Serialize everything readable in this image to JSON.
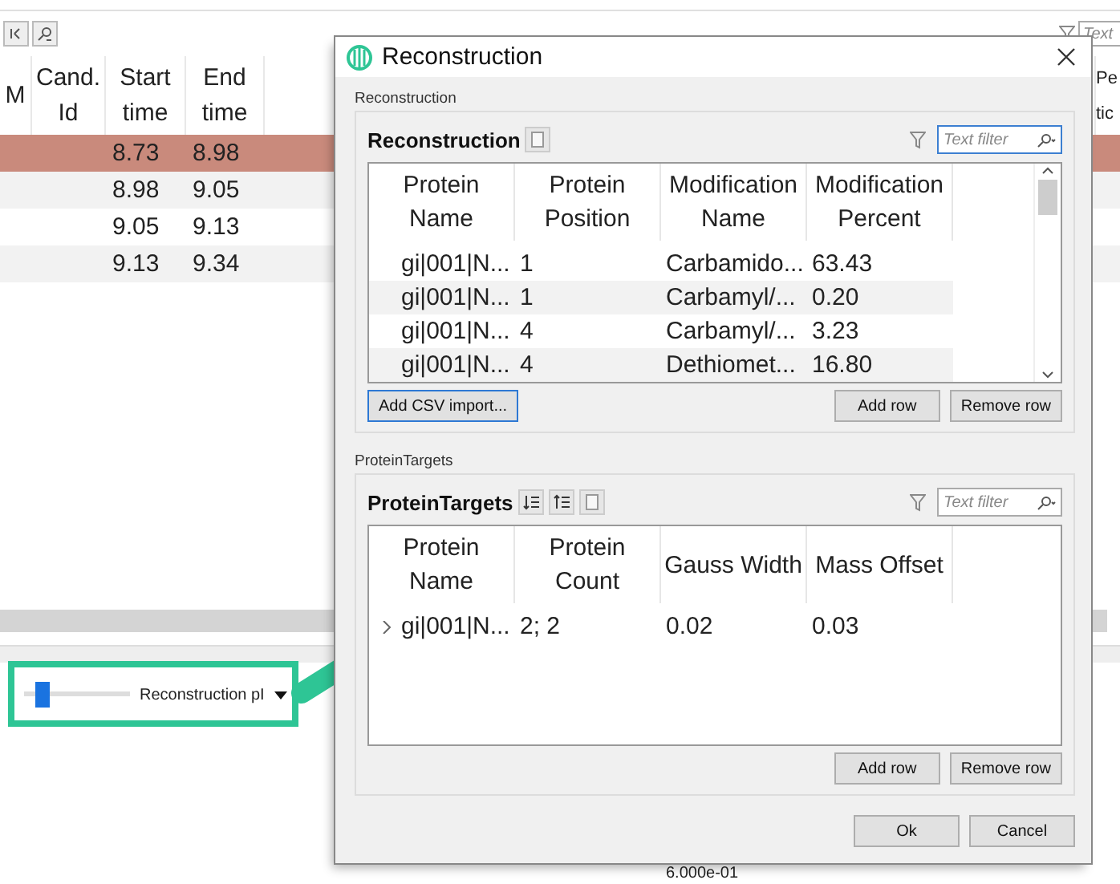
{
  "background": {
    "filter_field": {
      "placeholder": "Text"
    },
    "table": {
      "columns": [
        "M",
        "Cand. Id",
        "Start time",
        "End time",
        "",
        "Pe tic"
      ],
      "rows": [
        {
          "selected": true,
          "cells": [
            "",
            "",
            "8.73",
            "8.98",
            "",
            ""
          ]
        },
        {
          "selected": false,
          "cells": [
            "",
            "",
            "8.98",
            "9.05",
            "",
            ""
          ]
        },
        {
          "selected": false,
          "cells": [
            "",
            "",
            "9.05",
            "9.13",
            "",
            ""
          ]
        },
        {
          "selected": false,
          "cells": [
            "",
            "",
            "9.13",
            "9.34",
            "",
            ""
          ]
        }
      ]
    },
    "slider": {
      "level": 0.12,
      "label": "Reconstruction pI"
    },
    "axis_label": "6.000e-01"
  },
  "dialog": {
    "title": "Reconstruction",
    "groups": [
      {
        "label": "Reconstruction",
        "title": "Reconstruction",
        "tools": [
          {
            "kind": "export"
          }
        ],
        "filter": {
          "placeholder": "Text filter",
          "focused": true
        },
        "columns": [
          "Protein Name",
          "Protein Position",
          "Modification Name",
          "Modification Percent"
        ],
        "rows": [
          {
            "cells": [
              "gi|001|N...",
              "1",
              "Carbamido...",
              "63.43"
            ]
          },
          {
            "cells": [
              "gi|001|N...",
              "1",
              "Carbamyl/...",
              "0.20"
            ]
          },
          {
            "cells": [
              "gi|001|N...",
              "4",
              "Carbamyl/...",
              "3.23"
            ]
          },
          {
            "cells": [
              "gi|001|N...",
              "4",
              "Dethiomet...",
              "16.80"
            ]
          }
        ],
        "scrollbar": true,
        "buttons": [
          {
            "label": "Add CSV import...",
            "kind": "import",
            "focused": true
          },
          {
            "label": "Add row",
            "kind": "add",
            "focused": false
          },
          {
            "label": "Remove row",
            "kind": "remove",
            "focused": false
          }
        ]
      },
      {
        "label": "ProteinTargets",
        "title": "ProteinTargets",
        "tools": [
          {
            "kind": "sort-down"
          },
          {
            "kind": "sort-up"
          },
          {
            "kind": "export"
          }
        ],
        "filter": {
          "placeholder": "Text filter",
          "focused": false
        },
        "columns": [
          "Protein Name",
          "Protein Count",
          "Gauss Width",
          "Mass Offset"
        ],
        "rows": [
          {
            "expanded": false,
            "cells": [
              "gi|001|N...",
              "2; 2",
              "0.02",
              "0.03"
            ]
          }
        ],
        "scrollbar": false,
        "buttons": [
          {
            "label": "Add row",
            "kind": "add",
            "focused": false
          },
          {
            "label": "Remove row",
            "kind": "remove",
            "focused": false
          }
        ]
      }
    ],
    "buttons": [
      "Ok",
      "Cancel"
    ]
  }
}
